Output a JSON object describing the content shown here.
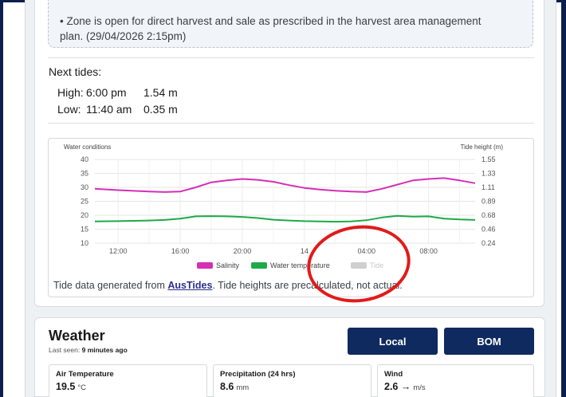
{
  "notice": {
    "text": "• Zone is open for direct harvest and sale as prescribed in the harvest area management plan. (29/04/2026 2:15pm)"
  },
  "tides": {
    "title": "Next tides:",
    "high": {
      "label": "High:",
      "time": "6:00 pm",
      "height": "1.54 m"
    },
    "low": {
      "label": "Low:",
      "time": "11:40 am",
      "height": "0.35 m"
    }
  },
  "chart_data": {
    "type": "line",
    "left_axis_label": "Water conditions",
    "right_axis_label": "Tide height (m)",
    "ylim": [
      10,
      40
    ],
    "y_ticks": [
      "40",
      "35",
      "30",
      "25",
      "20",
      "15",
      "10"
    ],
    "y2lim": [
      0.24,
      1.55
    ],
    "y2_ticks": [
      "1.55",
      "1.33",
      "1.11",
      "0.89",
      "0.68",
      "0.46",
      "0.24"
    ],
    "x_tick_labels": [
      "12:00",
      "16:00",
      "20:00",
      "14",
      "04:00",
      "08:00"
    ],
    "grid": true,
    "legend_placement": "bottom",
    "x_hours": [
      10.5,
      12,
      14,
      15,
      16,
      17,
      18,
      19,
      20,
      21,
      22,
      23,
      24,
      25,
      26,
      27,
      28,
      29,
      30,
      31,
      32,
      33,
      34,
      35
    ],
    "series": [
      {
        "name": "Salinity",
        "color": "#d42fb5",
        "values": [
          29.5,
          29.0,
          28.5,
          28.3,
          28.5,
          30.0,
          31.8,
          32.5,
          33.0,
          32.7,
          32.0,
          30.8,
          29.8,
          29.2,
          28.8,
          28.5,
          28.3,
          29.5,
          31.0,
          32.5,
          33.0,
          33.3,
          32.5,
          31.5
        ]
      },
      {
        "name": "Water temperature",
        "color": "#1fa94a",
        "values": [
          17.8,
          17.9,
          18.1,
          18.3,
          18.8,
          19.6,
          19.7,
          19.6,
          19.4,
          19.0,
          18.4,
          18.1,
          17.9,
          17.8,
          17.7,
          17.8,
          18.2,
          19.2,
          19.8,
          19.5,
          19.6,
          18.8,
          18.5,
          18.3
        ]
      },
      {
        "name": "Tide",
        "color": "#cfcfcf",
        "values": []
      }
    ],
    "note": {
      "prefix": "Tide data generated from ",
      "link": "AusTides",
      "suffix": ". Tide heights are precalculated, not actual."
    }
  },
  "weather": {
    "title": "Weather",
    "last_seen_label": "Last seen:",
    "last_seen_value": "9 minutes ago",
    "buttons": {
      "local": "Local",
      "bom": "BOM"
    },
    "metrics": [
      {
        "label": "Air Temperature",
        "value": "19.5",
        "unit": "°C"
      },
      {
        "label": "Precipitation (24 hrs)",
        "value": "8.6",
        "unit": "mm"
      },
      {
        "label": "Wind",
        "value": "2.6 →",
        "unit": "m/s"
      }
    ]
  },
  "colors": {
    "navy": "#0f2a5e",
    "annotation": "#e21a1a"
  }
}
